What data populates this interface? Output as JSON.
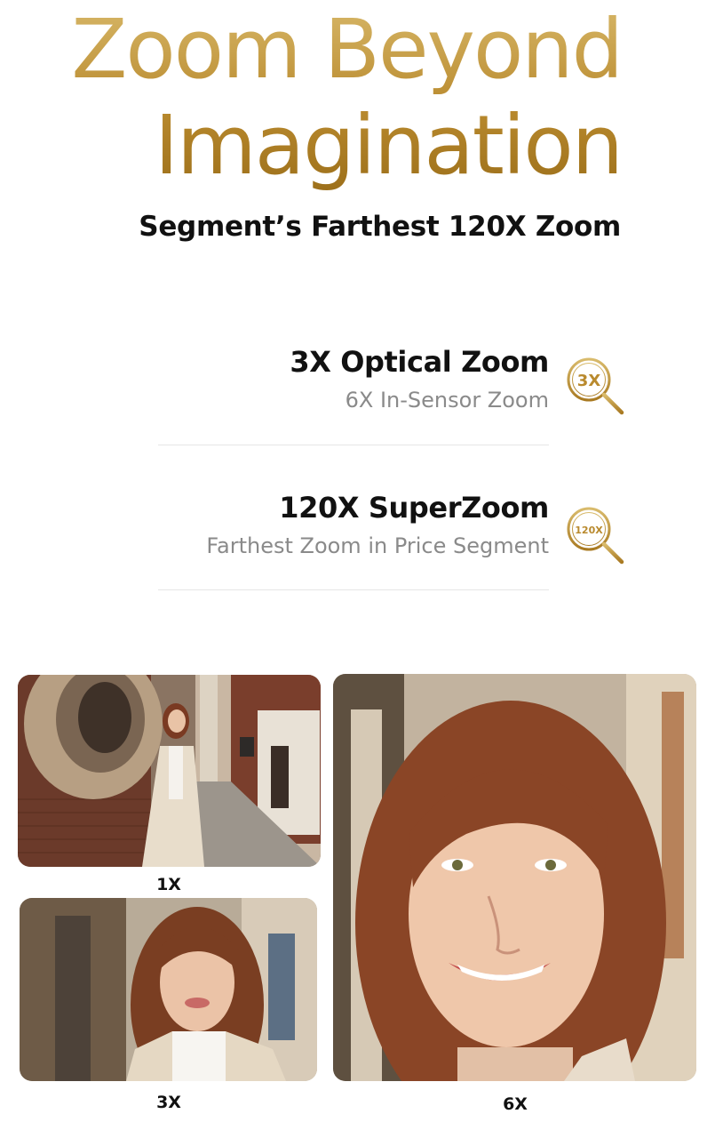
{
  "hero": {
    "title_line1": "Zoom Beyond",
    "title_line2": "Imagination",
    "subtitle": "Segment’s Farthest 120X Zoom"
  },
  "features": [
    {
      "title": "3X Optical Zoom",
      "description": "6X In-Sensor Zoom",
      "badge": "3X",
      "icon": "magnifier-3x-icon"
    },
    {
      "title": "120X SuperZoom",
      "description": "Farthest Zoom in Price Segment",
      "badge": "120X",
      "icon": "magnifier-120x-icon"
    }
  ],
  "gallery": [
    {
      "caption": "1X"
    },
    {
      "caption": "3X"
    },
    {
      "caption": "6X"
    }
  ],
  "colors": {
    "gold": "#b98a2e",
    "text": "#111111",
    "muted": "#8a8a8a"
  }
}
